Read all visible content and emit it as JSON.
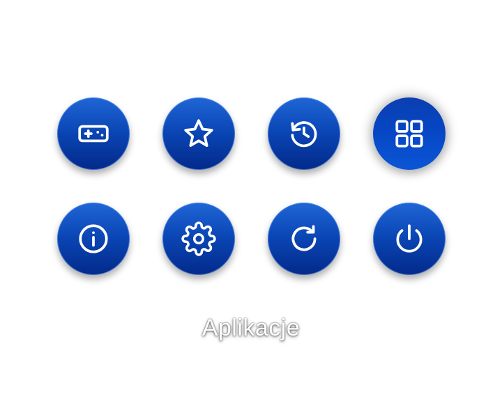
{
  "menu": {
    "items": [
      {
        "icon": "gamepad-icon",
        "action": "games"
      },
      {
        "icon": "star-icon",
        "action": "favorites"
      },
      {
        "icon": "history-icon",
        "action": "history"
      },
      {
        "icon": "apps-grid-icon",
        "action": "apps",
        "selected": true
      },
      {
        "icon": "info-icon",
        "action": "info"
      },
      {
        "icon": "gear-icon",
        "action": "settings"
      },
      {
        "icon": "refresh-icon",
        "action": "refresh"
      },
      {
        "icon": "power-icon",
        "action": "power"
      }
    ],
    "selected_label": "Aplikacje"
  },
  "colors": {
    "button_top": "#1f66d6",
    "button_bottom": "#032a8a",
    "icon_stroke": "#ffffff",
    "background": "#ffffff"
  }
}
